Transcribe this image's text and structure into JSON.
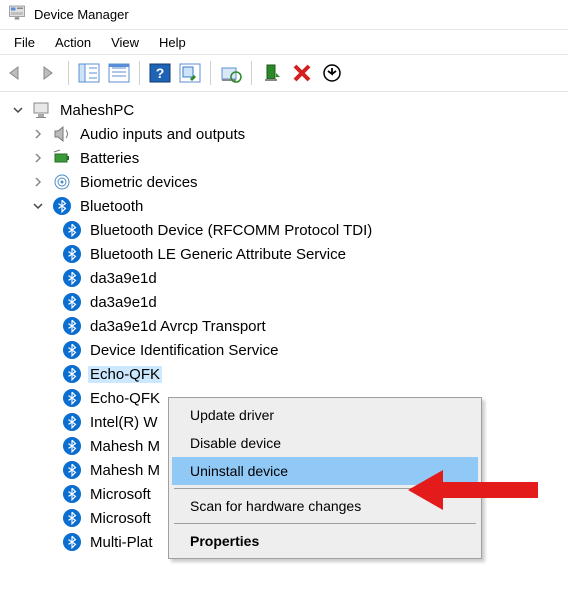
{
  "window": {
    "title": "Device Manager"
  },
  "menu": {
    "file": "File",
    "action": "Action",
    "view": "View",
    "help": "Help"
  },
  "tree": {
    "root": "MaheshPC",
    "cat_audio": "Audio inputs and outputs",
    "cat_batteries": "Batteries",
    "cat_biometric": "Biometric devices",
    "cat_bluetooth": "Bluetooth",
    "bt": {
      "i0": "Bluetooth Device (RFCOMM Protocol TDI)",
      "i1": "Bluetooth LE Generic Attribute Service",
      "i2": "da3a9e1d",
      "i3": "da3a9e1d",
      "i4": "da3a9e1d Avrcp Transport",
      "i5": "Device Identification Service",
      "i6": "Echo-QFK",
      "i7": "Echo-QFK",
      "i8": "Intel(R) W",
      "i9": "Mahesh M",
      "i10": "Mahesh M",
      "i11": "Microsoft",
      "i12": "Microsoft",
      "i13": "Multi-Plat"
    }
  },
  "context": {
    "update": "Update driver",
    "disable": "Disable device",
    "uninstall": "Uninstall device",
    "scan": "Scan for hardware changes",
    "properties": "Properties"
  }
}
